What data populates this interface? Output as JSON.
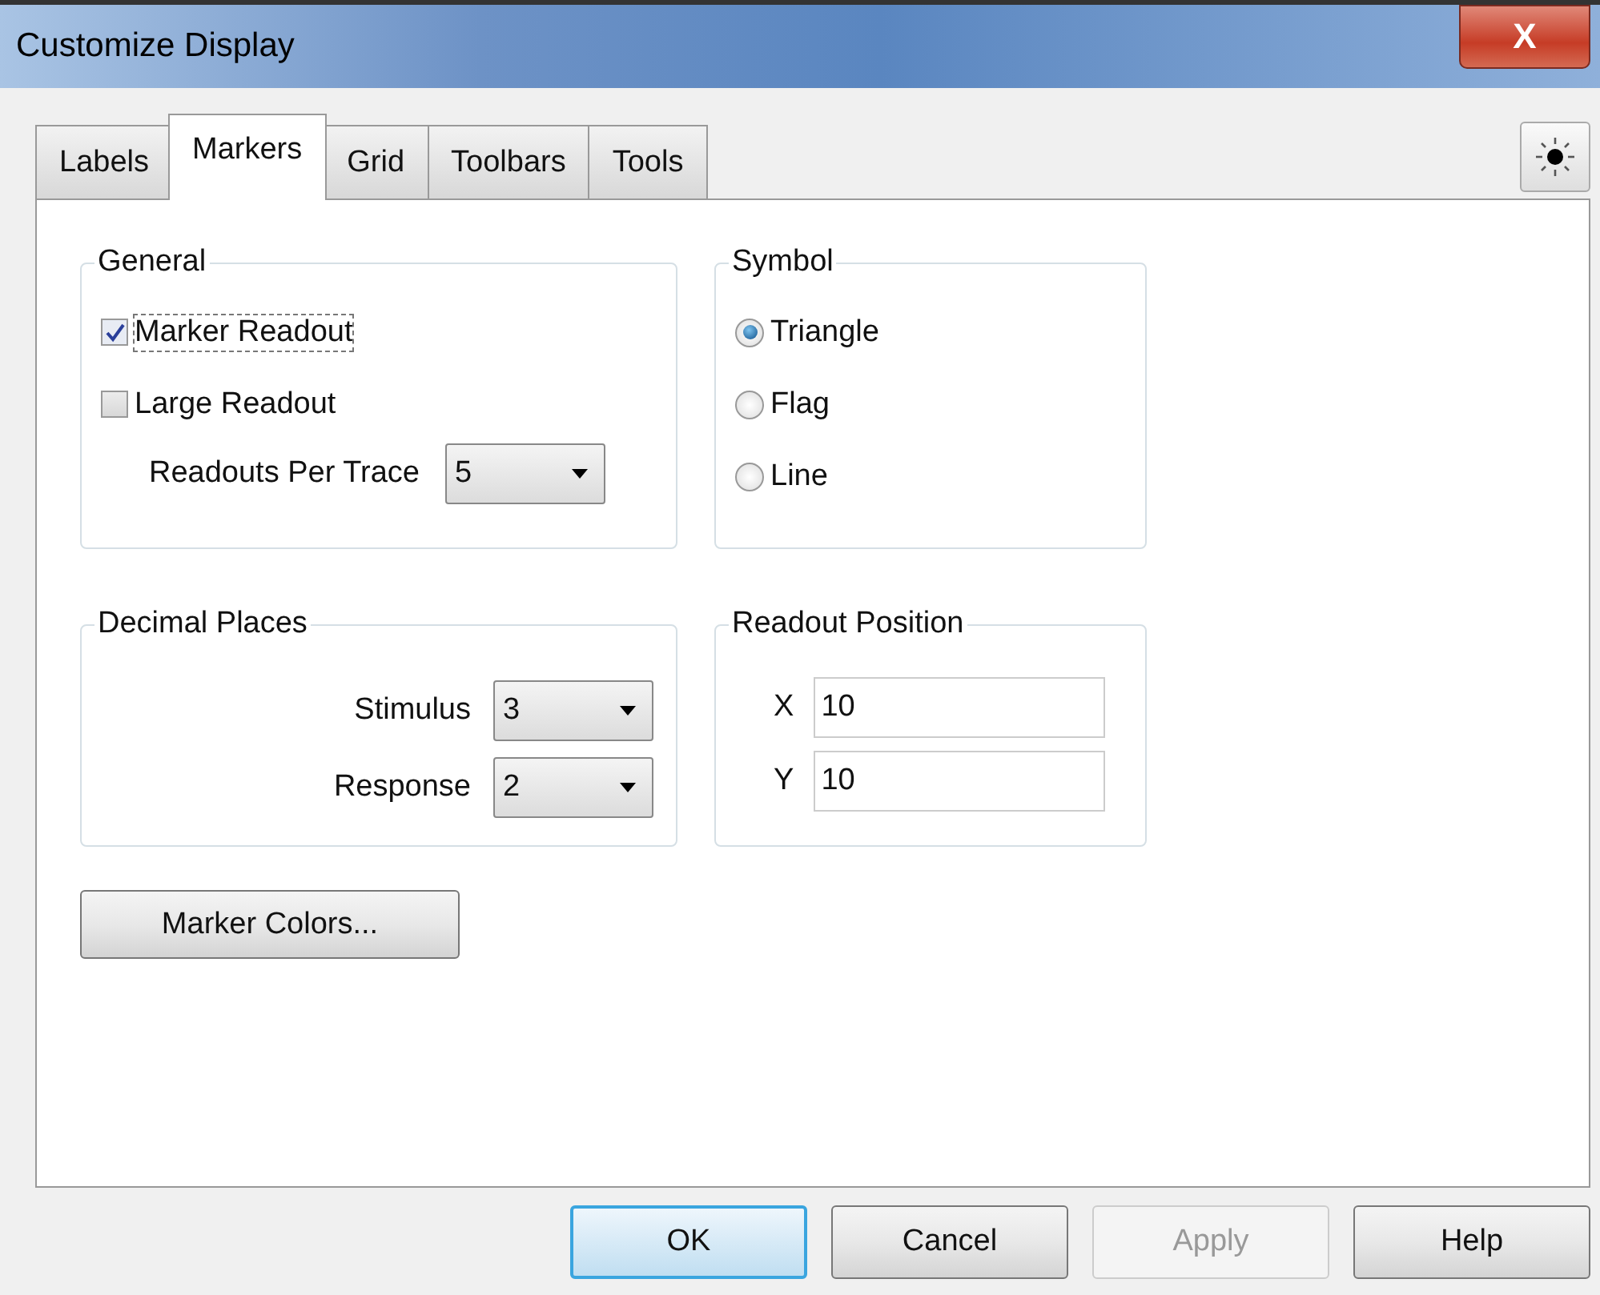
{
  "window": {
    "title": "Customize Display",
    "close_label": "X"
  },
  "tabs": [
    {
      "label": "Labels",
      "selected": false
    },
    {
      "label": "Markers",
      "selected": true
    },
    {
      "label": "Grid",
      "selected": false
    },
    {
      "label": "Toolbars",
      "selected": false
    },
    {
      "label": "Tools",
      "selected": false
    }
  ],
  "general": {
    "title": "General",
    "checkboxes": [
      {
        "label": "Marker Readout",
        "checked": true,
        "focused": true
      },
      {
        "label": "Large Readout",
        "checked": false,
        "focused": false
      }
    ],
    "readouts_per_trace": {
      "label": "Readouts Per Trace",
      "value": "5"
    }
  },
  "symbol": {
    "title": "Symbol",
    "options": [
      {
        "label": "Triangle",
        "selected": true
      },
      {
        "label": "Flag",
        "selected": false
      },
      {
        "label": "Line",
        "selected": false
      }
    ]
  },
  "decimal_places": {
    "title": "Decimal Places",
    "fields": [
      {
        "label": "Stimulus",
        "value": "3"
      },
      {
        "label": "Response",
        "value": "2"
      }
    ]
  },
  "readout_position": {
    "title": "Readout Position",
    "fields": [
      {
        "label": "X",
        "value": "10"
      },
      {
        "label": "Y",
        "value": "10"
      }
    ]
  },
  "marker_colors_button": "Marker Colors...",
  "buttons": [
    {
      "label": "OK",
      "default": true,
      "disabled": false
    },
    {
      "label": "Cancel",
      "default": false,
      "disabled": false
    },
    {
      "label": "Apply",
      "default": false,
      "disabled": true
    },
    {
      "label": "Help",
      "default": false,
      "disabled": false
    }
  ]
}
